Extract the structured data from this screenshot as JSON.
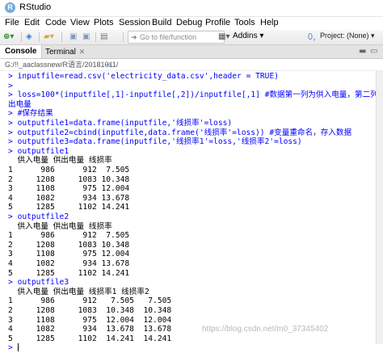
{
  "window": {
    "title": "RStudio"
  },
  "menu": [
    "File",
    "Edit",
    "Code",
    "View",
    "Plots",
    "Session",
    "Build",
    "Debug",
    "Profile",
    "Tools",
    "Help"
  ],
  "toolbar": {
    "goto_placeholder": "Go to file/function",
    "addins_label": "Addins",
    "project_label": "Project: (None)"
  },
  "tabs": {
    "console": "Console",
    "terminal": "Terminal"
  },
  "path": "G:/!!_aaclassnew/R语言/20181011/",
  "console": {
    "lines": [
      {
        "p": "> ",
        "t": "inputfile=read.csv('electricity_data.csv',header = TRUE)",
        "k": "cmd"
      },
      {
        "p": "> ",
        "t": "",
        "k": "cmd"
      },
      {
        "p": "> ",
        "t": "loss=100*(inputfile[,1]-inputfile[,2])/inputfile[,1] #数据第一列为供入电量，第二列为供",
        "k": "cmd"
      },
      {
        "p": "",
        "t": "出电量",
        "k": "cmd"
      },
      {
        "p": "> ",
        "t": "#保存结果",
        "k": "cmd"
      },
      {
        "p": "> ",
        "t": "outputfile1=data.frame(inputfile,'线损率'=loss)",
        "k": "cmd"
      },
      {
        "p": "> ",
        "t": "outputfile2=cbind(inputfile,data.frame('线损率'=loss)) #变量重命名，存入数据",
        "k": "cmd"
      },
      {
        "p": "> ",
        "t": "outputfile3=data.frame(inputfile,'线损率1'=loss,'线损率2'=loss)",
        "k": "cmd"
      },
      {
        "p": "> ",
        "t": "outputfile1",
        "k": "cmd"
      },
      {
        "p": "",
        "t": "  供入电量 供出电量 线损率",
        "k": "out"
      },
      {
        "p": "",
        "t": "1      986      912  7.505",
        "k": "out"
      },
      {
        "p": "",
        "t": "2     1208     1083 10.348",
        "k": "out"
      },
      {
        "p": "",
        "t": "3     1108      975 12.004",
        "k": "out"
      },
      {
        "p": "",
        "t": "4     1082      934 13.678",
        "k": "out"
      },
      {
        "p": "",
        "t": "5     1285     1102 14.241",
        "k": "out"
      },
      {
        "p": "> ",
        "t": "outputfile2",
        "k": "cmd"
      },
      {
        "p": "",
        "t": "  供入电量 供出电量 线损率",
        "k": "out"
      },
      {
        "p": "",
        "t": "1      986      912  7.505",
        "k": "out"
      },
      {
        "p": "",
        "t": "2     1208     1083 10.348",
        "k": "out"
      },
      {
        "p": "",
        "t": "3     1108      975 12.004",
        "k": "out"
      },
      {
        "p": "",
        "t": "4     1082      934 13.678",
        "k": "out"
      },
      {
        "p": "",
        "t": "5     1285     1102 14.241",
        "k": "out"
      },
      {
        "p": "> ",
        "t": "outputfile3",
        "k": "cmd"
      },
      {
        "p": "",
        "t": "  供入电量 供出电量 线损率1 线损率2",
        "k": "out"
      },
      {
        "p": "",
        "t": "1      986      912   7.505   7.505",
        "k": "out"
      },
      {
        "p": "",
        "t": "2     1208     1083  10.348  10.348",
        "k": "out"
      },
      {
        "p": "",
        "t": "3     1108      975  12.004  12.004",
        "k": "out"
      },
      {
        "p": "",
        "t": "4     1082      934  13.678  13.678",
        "k": "out"
      },
      {
        "p": "",
        "t": "5     1285     1102  14.241  14.241",
        "k": "out"
      },
      {
        "p": "> ",
        "t": "",
        "k": "cmd"
      }
    ]
  },
  "watermark": "https://blog.csdn.net/m0_37345402"
}
